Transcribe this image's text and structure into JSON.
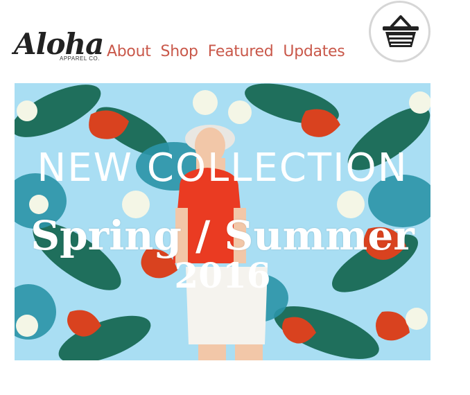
{
  "logo": {
    "script": "Aloha",
    "subtitle": "APPAREL CO."
  },
  "nav": {
    "items": [
      "About",
      "Shop",
      "Featured",
      "Updates"
    ]
  },
  "cart": {
    "icon": "basket-icon"
  },
  "hero": {
    "title": "NEW COLLECTION",
    "subtitle": "Spring / Summer",
    "year": "2016"
  },
  "colors": {
    "nav_link": "#c9584a",
    "hero_bg": "#a9def3",
    "logo": "#222222"
  }
}
